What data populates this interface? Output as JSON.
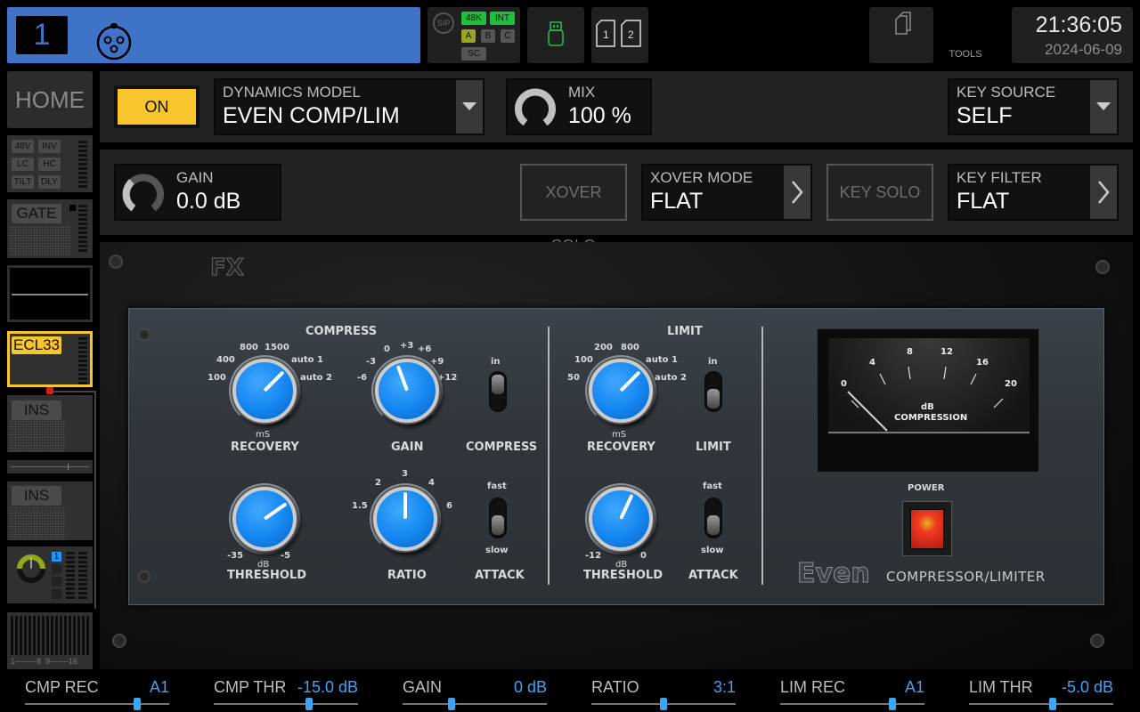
{
  "topbar": {
    "channel": {
      "number": "1",
      "icon": "xlr-input-icon",
      "color": "#3f73c8"
    },
    "sync": {
      "sip_label": "SIP",
      "rate": "48K",
      "clock": "INT",
      "slots": [
        "A",
        "B",
        "C"
      ],
      "active_slot": "A",
      "sc_label": "SC"
    },
    "usb": {
      "icon": "usb-drive-icon",
      "color": "#22c04a"
    },
    "cards": {
      "icon": "sd-card-icon",
      "slots": [
        "1",
        "2"
      ]
    },
    "tools": {
      "label": "TOOLS",
      "icon": "tools-documents-icon"
    },
    "clock": {
      "time": "21:36:05",
      "date": "2024-06-09"
    }
  },
  "left_strip": {
    "home": "HOME",
    "input_chips": [
      "48V",
      "INV",
      "LC",
      "HC",
      "TILT",
      "DLY"
    ],
    "gate": "GATE",
    "dynamics": "ECL33",
    "insert1": "INS",
    "insert2": "INS",
    "bus_badge": "1",
    "bus_range": "1--------8  9-------16"
  },
  "header": {
    "on_label": "ON",
    "model": {
      "label": "DYNAMICS MODEL",
      "value": "EVEN COMP/LIM"
    },
    "mix": {
      "label": "MIX",
      "value": "100 %",
      "percent": 100
    },
    "key_source": {
      "label": "KEY SOURCE",
      "value": "SELF"
    },
    "gain": {
      "label": "GAIN",
      "value": "0.0 dB"
    },
    "xover_solo": "XOVER SOLO",
    "xover_mode": {
      "label": "XOVER MODE",
      "value": "FLAT"
    },
    "key_solo": "KEY SOLO",
    "key_filter": {
      "label": "KEY FILTER",
      "value": "FLAT"
    }
  },
  "plugin": {
    "logo": "FX",
    "compress": {
      "title": "COMPRESS",
      "recovery": {
        "label": "RECOVERY",
        "unit": "mS",
        "scale": [
          "100",
          "400",
          "800",
          "1500",
          "auto 1",
          "auto 2"
        ]
      },
      "gain": {
        "label": "GAIN",
        "scale": [
          "-6",
          "-3",
          "0",
          "+3",
          "+6",
          "+9",
          "+12"
        ]
      },
      "switch": {
        "label": "COMPRESS",
        "top": "in"
      },
      "threshold": {
        "label": "THRESHOLD",
        "unit": "dB",
        "min": "-35",
        "max": "-5"
      },
      "ratio": {
        "label": "RATIO",
        "scale": [
          "1.5",
          "2",
          "3",
          "4",
          "6"
        ]
      },
      "attack": {
        "label": "ATTACK",
        "top": "fast",
        "bottom": "slow"
      }
    },
    "limit": {
      "title": "LIMIT",
      "recovery": {
        "label": "RECOVERY",
        "unit": "mS",
        "scale": [
          "50",
          "100",
          "200",
          "800",
          "auto 1",
          "auto 2"
        ]
      },
      "switch": {
        "label": "LIMIT",
        "top": "in"
      },
      "threshold": {
        "label": "THRESHOLD",
        "unit": "dB",
        "min": "-12",
        "max": "0"
      },
      "attack": {
        "label": "ATTACK",
        "top": "fast",
        "bottom": "slow"
      }
    },
    "meter": {
      "scale": [
        "0",
        "4",
        "8",
        "12",
        "16",
        "20"
      ],
      "unit": "dB",
      "label": "COMPRESSION",
      "value_db": 0
    },
    "power_label": "POWER",
    "brand": "Even",
    "brand_sub": "COMPRESSOR/LIMITER"
  },
  "bottom_params": [
    {
      "name": "CMP REC",
      "value": "A1",
      "position": 0.78
    },
    {
      "name": "CMP THR",
      "value": "-15.0 dB",
      "position": 0.66
    },
    {
      "name": "GAIN",
      "value": "0 dB",
      "position": 0.34
    },
    {
      "name": "RATIO",
      "value": "3:1",
      "position": 0.5
    },
    {
      "name": "LIM REC",
      "value": "A1",
      "position": 0.78
    },
    {
      "name": "LIM THR",
      "value": "-5.0 dB",
      "position": 0.58
    }
  ]
}
